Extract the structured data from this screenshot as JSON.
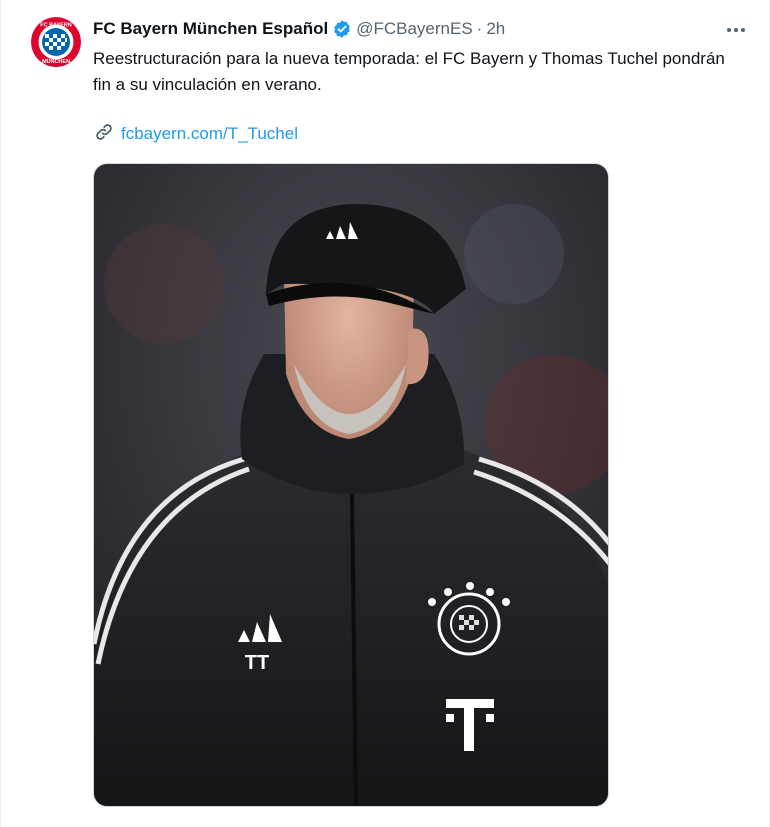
{
  "tweet": {
    "author_name": "FC Bayern München Español",
    "handle": "@FCBayernES",
    "separator": "·",
    "time": "2h",
    "text": "Reestructuración para la nueva temporada: el FC Bayern y Thomas Tuchel pondrán fin a su vinculación en verano.",
    "link_label": "fcbayern.com/T_Tuchel",
    "media_image_icon": "tuchel-photo",
    "more_icon": "more-horizontal-icon",
    "verified_icon": "verified-badge-icon",
    "link_icon": "link-icon",
    "avatar_icon": "fc-bayern-crest",
    "avatar_lettering": "FC BAYERN MÜNCHEN"
  },
  "colors": {
    "text_primary": "#0f1419",
    "text_secondary": "#536471",
    "link": "#1d9bf0",
    "verified": "#1d9bf0",
    "bayern_red": "#dc052d",
    "bayern_blue": "#0066b2"
  }
}
